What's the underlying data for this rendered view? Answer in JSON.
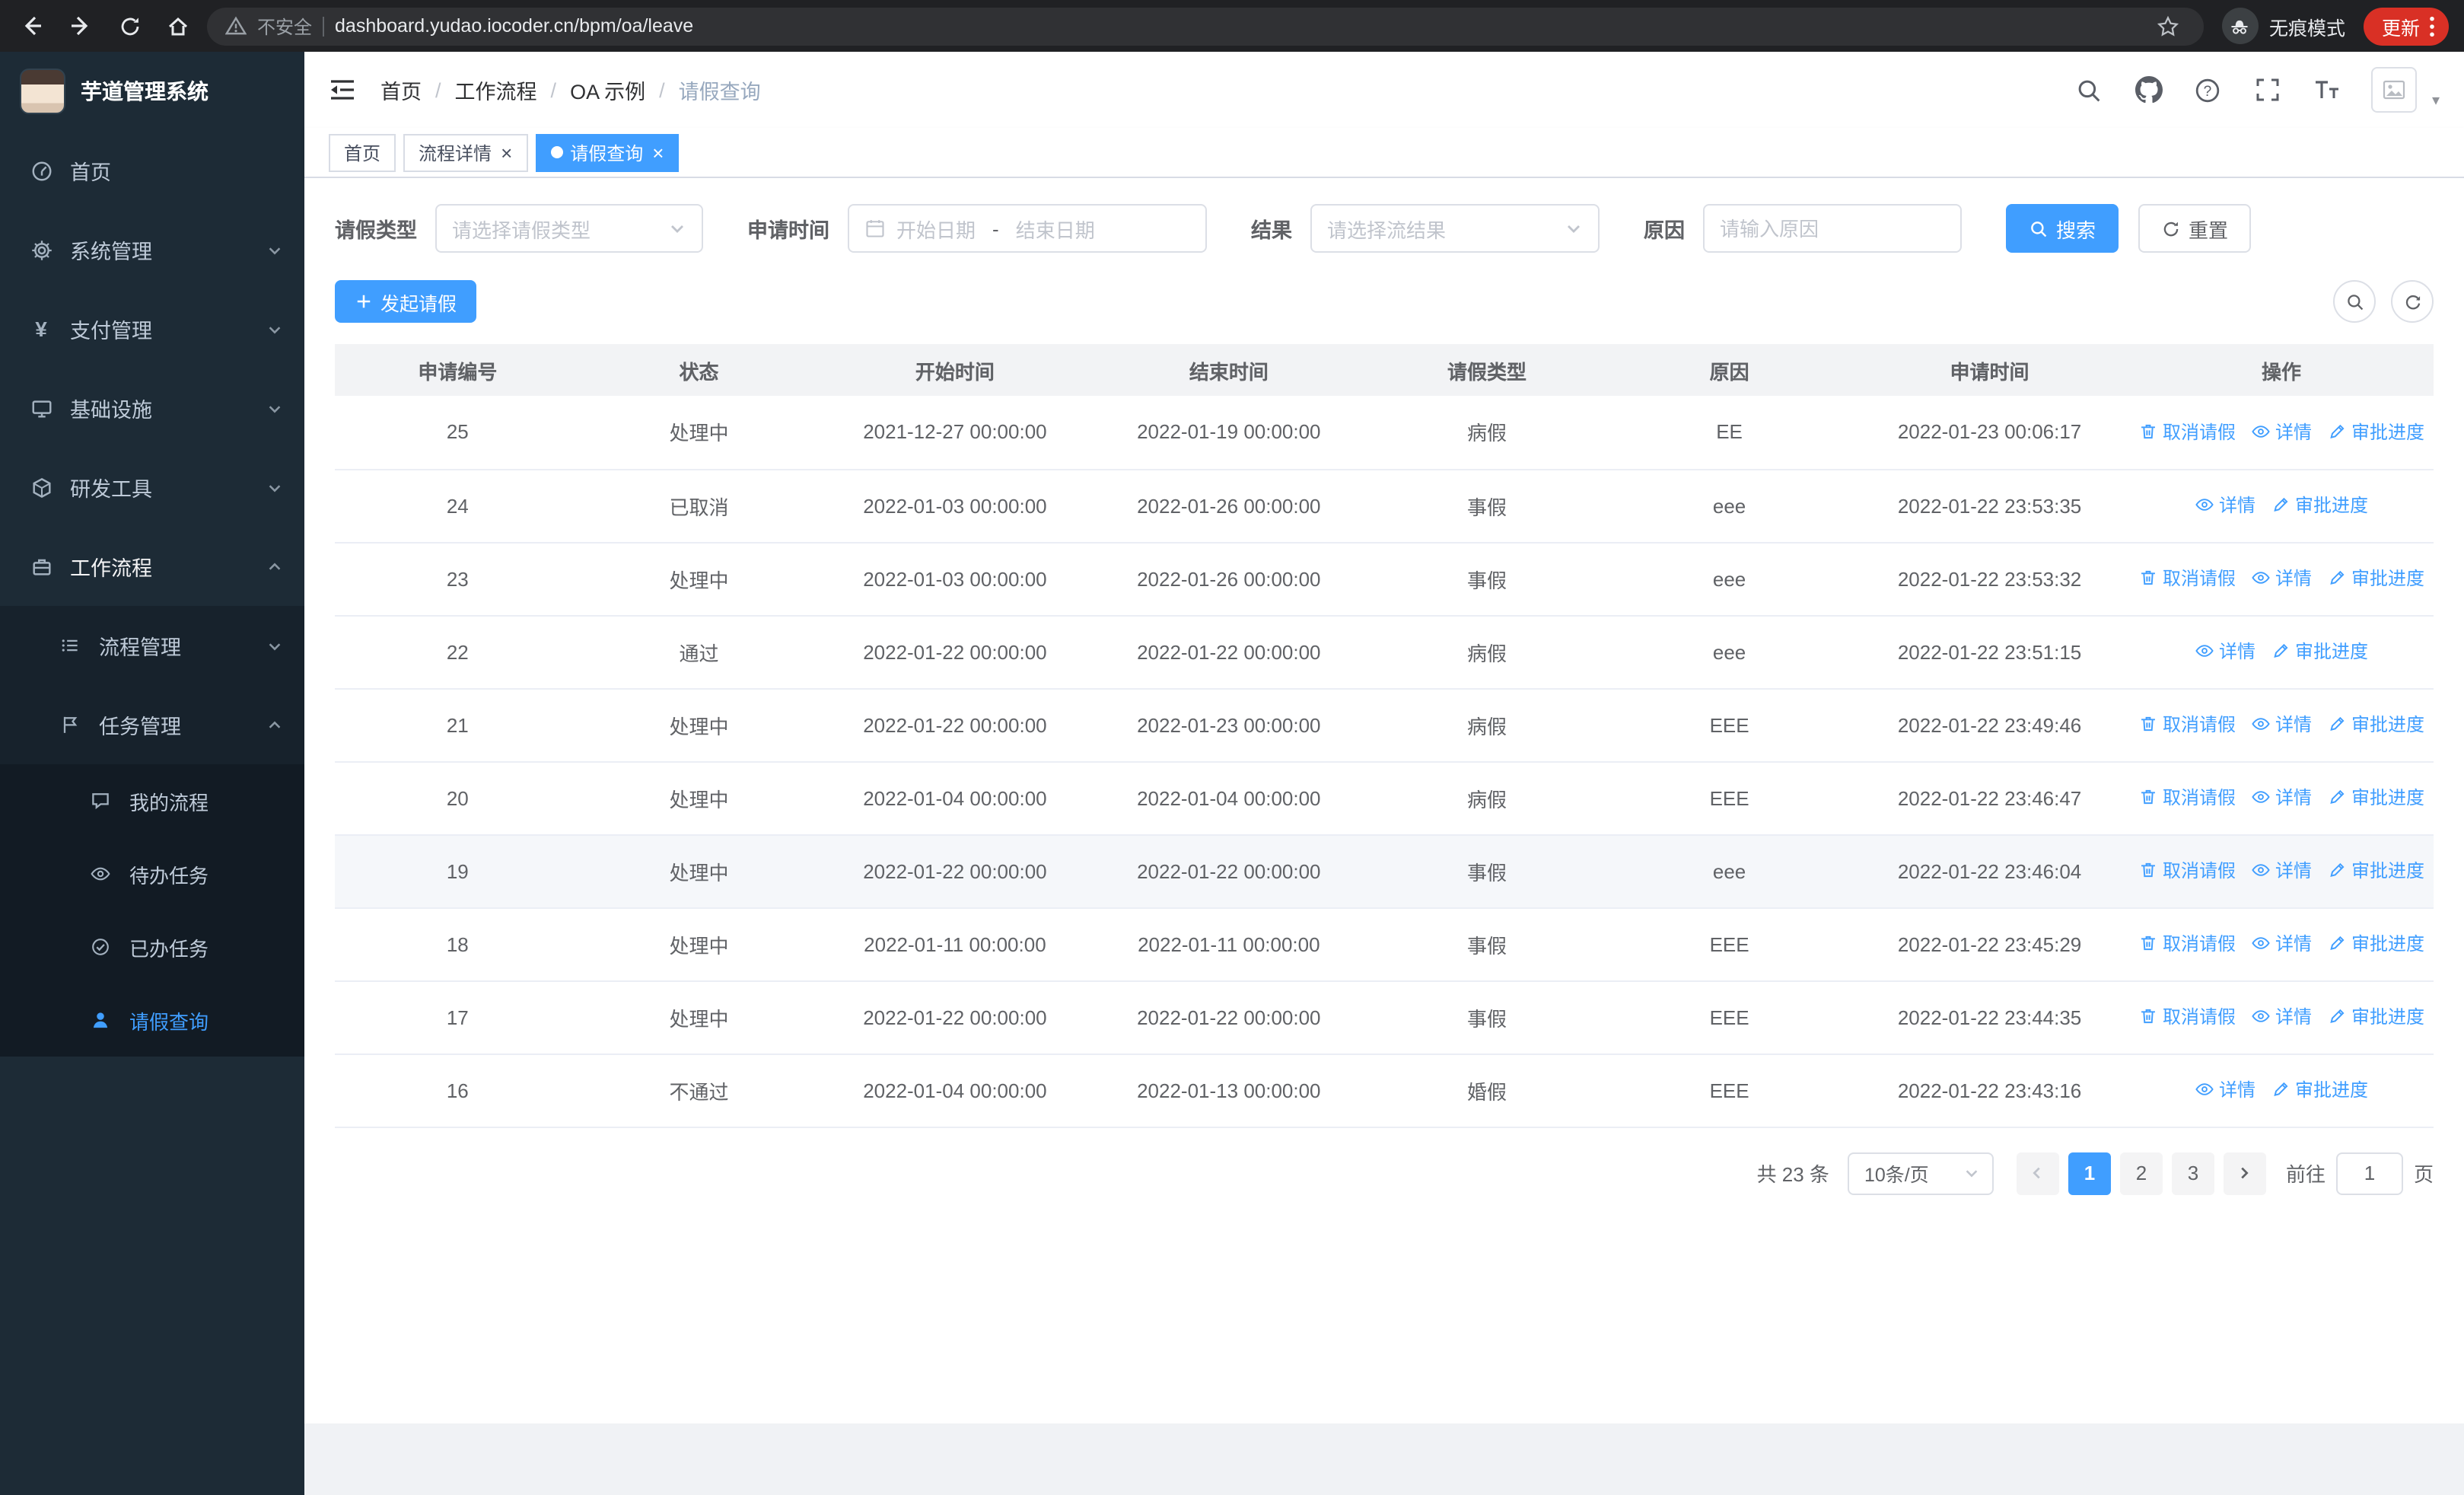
{
  "browser": {
    "security_label": "不安全",
    "url": "dashboard.yudao.iocoder.cn/bpm/oa/leave",
    "incognito_label": "无痕模式",
    "update_label": "更新"
  },
  "icons": {
    "yen": "¥",
    "question": "?",
    "caret": "▾",
    "close": "×"
  },
  "sidebar": {
    "logo_title": "芋道管理系统",
    "items": [
      {
        "label": "首页"
      },
      {
        "label": "系统管理"
      },
      {
        "label": "支付管理"
      },
      {
        "label": "基础设施"
      },
      {
        "label": "研发工具"
      },
      {
        "label": "工作流程"
      }
    ],
    "workflow_children": [
      {
        "label": "流程管理"
      },
      {
        "label": "任务管理"
      }
    ],
    "task_children": [
      {
        "label": "我的流程"
      },
      {
        "label": "待办任务"
      },
      {
        "label": "已办任务"
      },
      {
        "label": "请假查询"
      }
    ]
  },
  "header": {
    "breadcrumb": [
      "首页",
      "工作流程",
      "OA 示例",
      "请假查询"
    ]
  },
  "tabs": [
    {
      "label": "首页"
    },
    {
      "label": "流程详情"
    },
    {
      "label": "请假查询"
    }
  ],
  "filters": {
    "leave_type_label": "请假类型",
    "leave_type_placeholder": "请选择请假类型",
    "apply_time_label": "申请时间",
    "start_date_placeholder": "开始日期",
    "date_separator": "-",
    "end_date_placeholder": "结束日期",
    "result_label": "结果",
    "result_placeholder": "请选择流结果",
    "reason_label": "原因",
    "reason_placeholder": "请输入原因",
    "search_button": "搜索",
    "reset_button": "重置"
  },
  "toolbar": {
    "create_button": "发起请假"
  },
  "table": {
    "columns": [
      "申请编号",
      "状态",
      "开始时间",
      "结束时间",
      "请假类型",
      "原因",
      "申请时间",
      "操作"
    ],
    "action_labels": {
      "cancel": "取消请假",
      "detail": "详情",
      "progress": "审批进度"
    },
    "rows": [
      {
        "id": "25",
        "status": "处理中",
        "start_time": "2021-12-27 00:00:00",
        "end_time": "2022-01-19 00:00:00",
        "leave_type": "病假",
        "reason": "EE",
        "apply_time": "2022-01-23 00:06:17",
        "actions": [
          "cancel",
          "detail",
          "progress"
        ],
        "highlighted": false
      },
      {
        "id": "24",
        "status": "已取消",
        "start_time": "2022-01-03 00:00:00",
        "end_time": "2022-01-26 00:00:00",
        "leave_type": "事假",
        "reason": "eee",
        "apply_time": "2022-01-22 23:53:35",
        "actions": [
          "detail",
          "progress"
        ],
        "highlighted": false
      },
      {
        "id": "23",
        "status": "处理中",
        "start_time": "2022-01-03 00:00:00",
        "end_time": "2022-01-26 00:00:00",
        "leave_type": "事假",
        "reason": "eee",
        "apply_time": "2022-01-22 23:53:32",
        "actions": [
          "cancel",
          "detail",
          "progress"
        ],
        "highlighted": false
      },
      {
        "id": "22",
        "status": "通过",
        "start_time": "2022-01-22 00:00:00",
        "end_time": "2022-01-22 00:00:00",
        "leave_type": "病假",
        "reason": "eee",
        "apply_time": "2022-01-22 23:51:15",
        "actions": [
          "detail",
          "progress"
        ],
        "highlighted": false
      },
      {
        "id": "21",
        "status": "处理中",
        "start_time": "2022-01-22 00:00:00",
        "end_time": "2022-01-23 00:00:00",
        "leave_type": "病假",
        "reason": "EEE",
        "apply_time": "2022-01-22 23:49:46",
        "actions": [
          "cancel",
          "detail",
          "progress"
        ],
        "highlighted": false
      },
      {
        "id": "20",
        "status": "处理中",
        "start_time": "2022-01-04 00:00:00",
        "end_time": "2022-01-04 00:00:00",
        "leave_type": "病假",
        "reason": "EEE",
        "apply_time": "2022-01-22 23:46:47",
        "actions": [
          "cancel",
          "detail",
          "progress"
        ],
        "highlighted": false
      },
      {
        "id": "19",
        "status": "处理中",
        "start_time": "2022-01-22 00:00:00",
        "end_time": "2022-01-22 00:00:00",
        "leave_type": "事假",
        "reason": "eee",
        "apply_time": "2022-01-22 23:46:04",
        "actions": [
          "cancel",
          "detail",
          "progress"
        ],
        "highlighted": true
      },
      {
        "id": "18",
        "status": "处理中",
        "start_time": "2022-01-11 00:00:00",
        "end_time": "2022-01-11 00:00:00",
        "leave_type": "事假",
        "reason": "EEE",
        "apply_time": "2022-01-22 23:45:29",
        "actions": [
          "cancel",
          "detail",
          "progress"
        ],
        "highlighted": false
      },
      {
        "id": "17",
        "status": "处理中",
        "start_time": "2022-01-22 00:00:00",
        "end_time": "2022-01-22 00:00:00",
        "leave_type": "事假",
        "reason": "EEE",
        "apply_time": "2022-01-22 23:44:35",
        "actions": [
          "cancel",
          "detail",
          "progress"
        ],
        "highlighted": false
      },
      {
        "id": "16",
        "status": "不通过",
        "start_time": "2022-01-04 00:00:00",
        "end_time": "2022-01-13 00:00:00",
        "leave_type": "婚假",
        "reason": "EEE",
        "apply_time": "2022-01-22 23:43:16",
        "actions": [
          "detail",
          "progress"
        ],
        "highlighted": false
      }
    ]
  },
  "pagination": {
    "total_text": "共 23 条",
    "page_size_value": "10条/页",
    "pages": [
      "1",
      "2",
      "3"
    ],
    "active_page": "1",
    "goto_label": "前往",
    "goto_value": "1",
    "goto_suffix": "页"
  }
}
